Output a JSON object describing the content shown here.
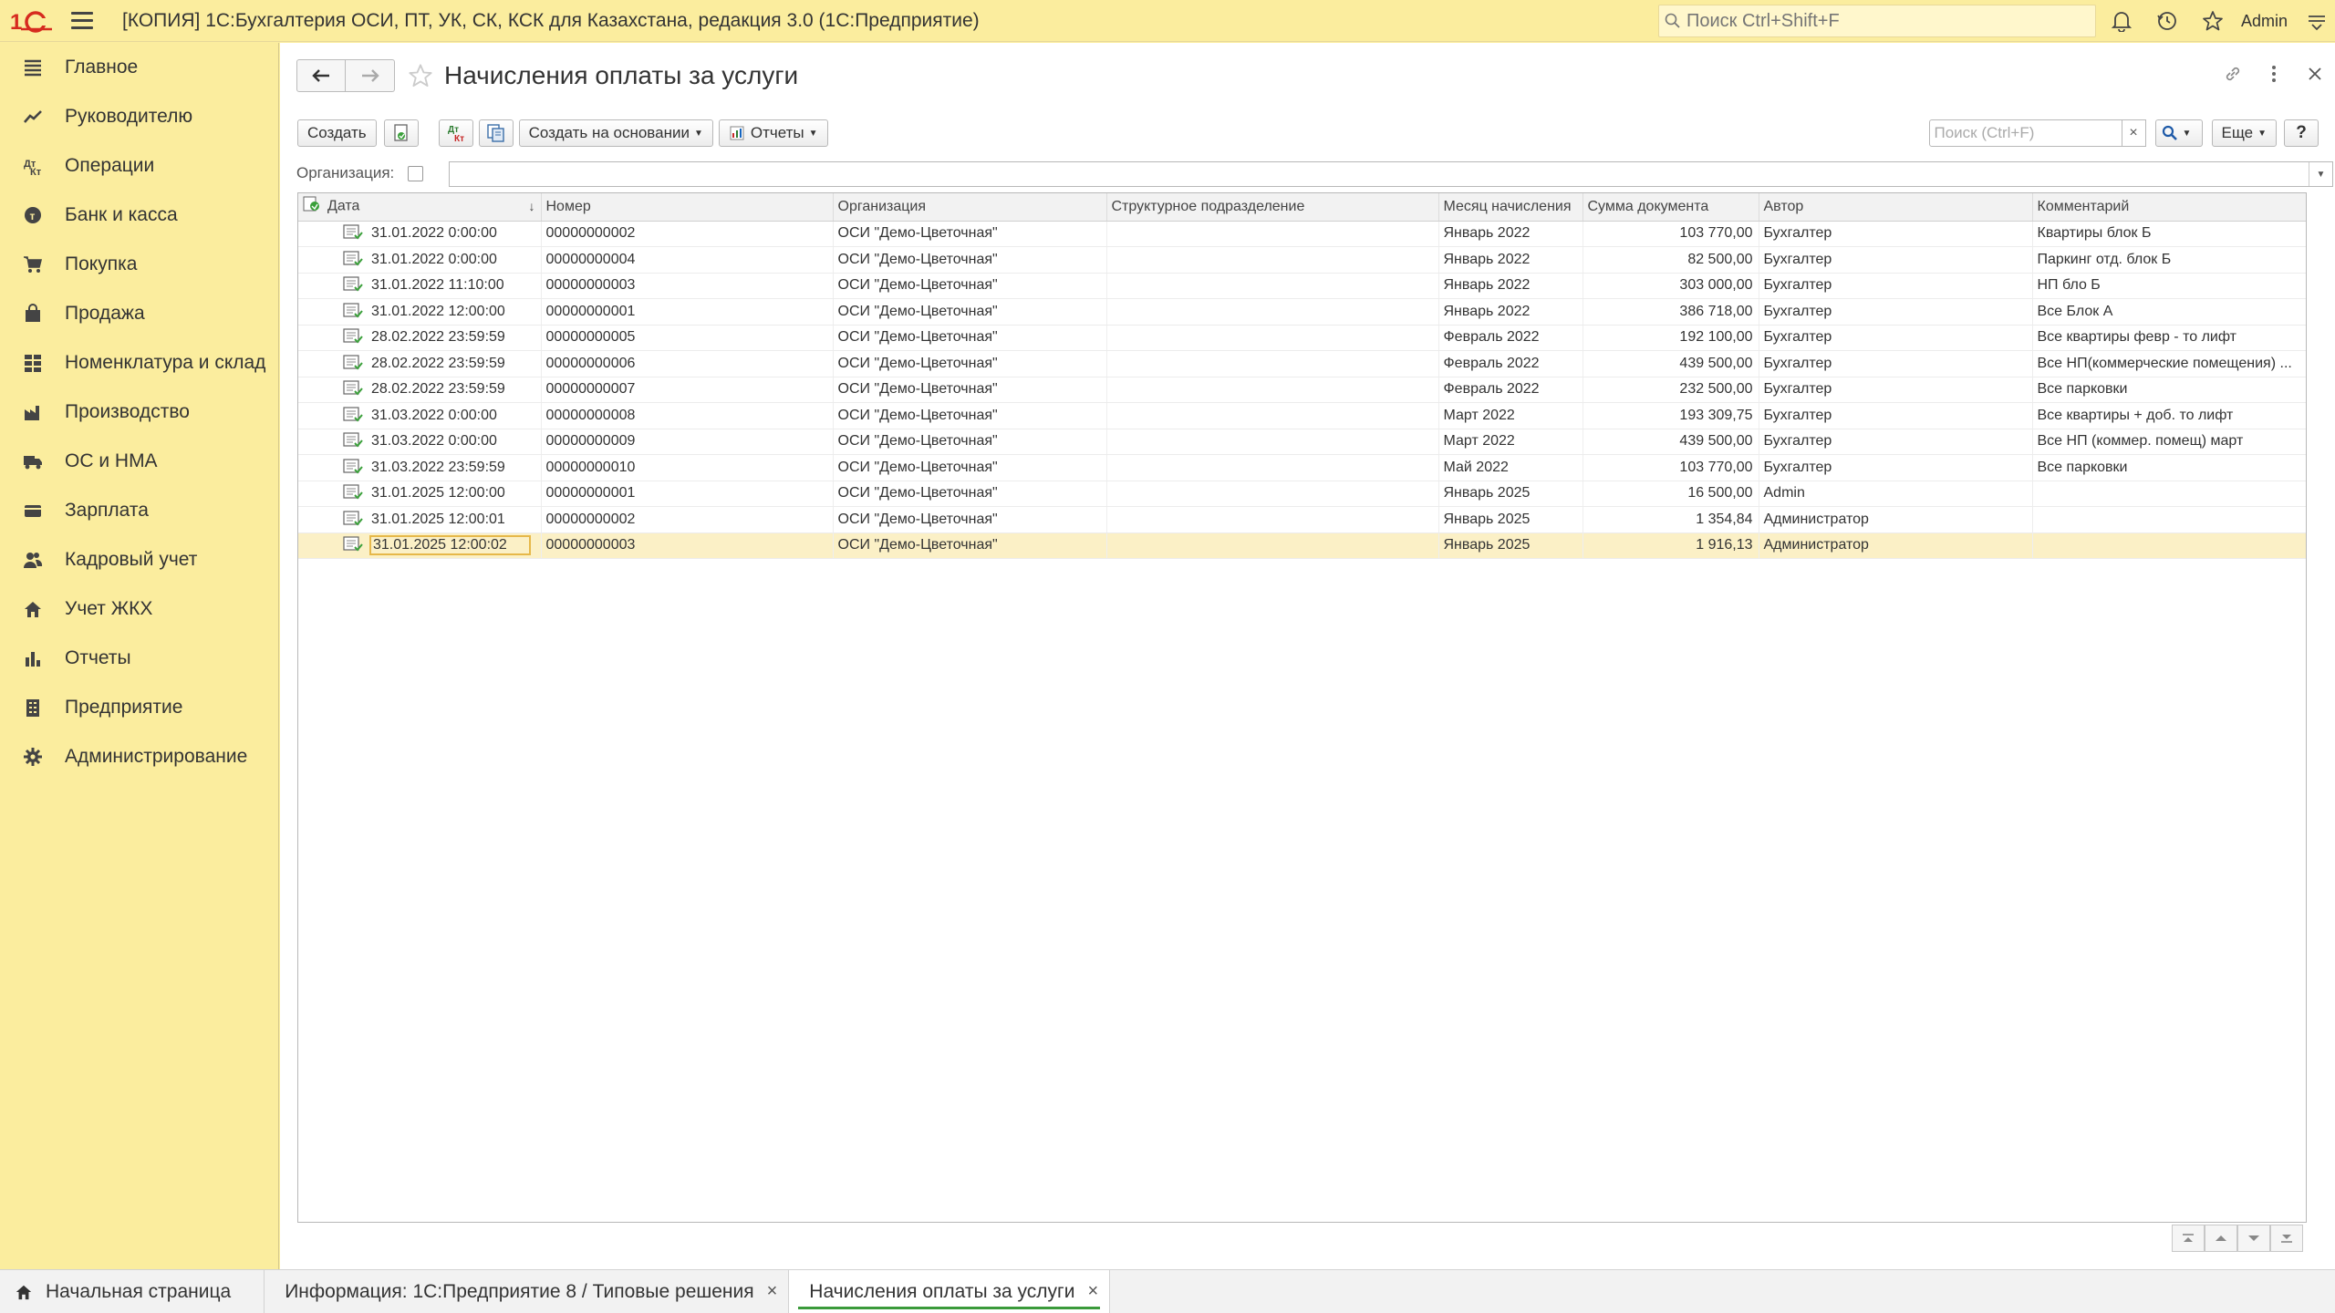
{
  "app": {
    "title": "[КОПИЯ] 1С:Бухгалтерия ОСИ, ПТ, УК, СК, КСК для Казахстана, редакция 3.0  (1С:Предприятие)",
    "search_placeholder": "Поиск Ctrl+Shift+F",
    "user": "Admin"
  },
  "sidebar": {
    "items": [
      {
        "label": "Главное",
        "icon": "menu-lines-icon"
      },
      {
        "label": "Руководителю",
        "icon": "trend-icon"
      },
      {
        "label": "Операции",
        "icon": "operations-icon"
      },
      {
        "label": "Банк и касса",
        "icon": "coins-icon"
      },
      {
        "label": "Покупка",
        "icon": "cart-icon"
      },
      {
        "label": "Продажа",
        "icon": "bag-icon"
      },
      {
        "label": "Номенклатура и склад",
        "icon": "grid-icon"
      },
      {
        "label": "Производство",
        "icon": "factory-icon"
      },
      {
        "label": "ОС и НМА",
        "icon": "truck-icon"
      },
      {
        "label": "Зарплата",
        "icon": "wallet-icon"
      },
      {
        "label": "Кадровый учет",
        "icon": "people-icon"
      },
      {
        "label": "Учет ЖКХ",
        "icon": "house-icon"
      },
      {
        "label": "Отчеты",
        "icon": "bar-chart-icon"
      },
      {
        "label": "Предприятие",
        "icon": "building-icon"
      },
      {
        "label": "Администрирование",
        "icon": "gear-icon"
      }
    ]
  },
  "form": {
    "title": "Начисления оплаты за услуги"
  },
  "toolbar": {
    "create_label": "Создать",
    "create_based_label": "Создать на основании",
    "reports_label": "Отчеты",
    "search_placeholder": "Поиск (Ctrl+F)",
    "more_label": "Еще",
    "help_label": "?"
  },
  "filter": {
    "org_label": "Организация:"
  },
  "table": {
    "columns": [
      "Дата",
      "Номер",
      "Организация",
      "Структурное подразделение",
      "Месяц начисления",
      "Сумма документа",
      "Автор",
      "Комментарий"
    ],
    "rows": [
      {
        "date": "31.01.2022 0:00:00",
        "number": "00000000002",
        "org": "ОСИ \"Демо-Цветочная\"",
        "dept": "",
        "month": "Январь 2022",
        "sum": "103 770,00",
        "author": "Бухгалтер",
        "comment": "Квартиры блок Б"
      },
      {
        "date": "31.01.2022 0:00:00",
        "number": "00000000004",
        "org": "ОСИ \"Демо-Цветочная\"",
        "dept": "",
        "month": "Январь 2022",
        "sum": "82 500,00",
        "author": "Бухгалтер",
        "comment": "Паркинг отд. блок Б"
      },
      {
        "date": "31.01.2022 11:10:00",
        "number": "00000000003",
        "org": "ОСИ \"Демо-Цветочная\"",
        "dept": "",
        "month": "Январь 2022",
        "sum": "303 000,00",
        "author": "Бухгалтер",
        "comment": "НП бло Б"
      },
      {
        "date": "31.01.2022 12:00:00",
        "number": "00000000001",
        "org": "ОСИ \"Демо-Цветочная\"",
        "dept": "",
        "month": "Январь 2022",
        "sum": "386 718,00",
        "author": "Бухгалтер",
        "comment": "Все Блок А"
      },
      {
        "date": "28.02.2022 23:59:59",
        "number": "00000000005",
        "org": "ОСИ \"Демо-Цветочная\"",
        "dept": "",
        "month": "Февраль 2022",
        "sum": "192 100,00",
        "author": "Бухгалтер",
        "comment": "Все квартиры февр - то лифт"
      },
      {
        "date": "28.02.2022 23:59:59",
        "number": "00000000006",
        "org": "ОСИ \"Демо-Цветочная\"",
        "dept": "",
        "month": "Февраль 2022",
        "sum": "439 500,00",
        "author": "Бухгалтер",
        "comment": "Все НП(коммерческие помещения) ..."
      },
      {
        "date": "28.02.2022 23:59:59",
        "number": "00000000007",
        "org": "ОСИ \"Демо-Цветочная\"",
        "dept": "",
        "month": "Февраль 2022",
        "sum": "232 500,00",
        "author": "Бухгалтер",
        "comment": "Все парковки"
      },
      {
        "date": "31.03.2022 0:00:00",
        "number": "00000000008",
        "org": "ОСИ \"Демо-Цветочная\"",
        "dept": "",
        "month": "Март 2022",
        "sum": "193 309,75",
        "author": "Бухгалтер",
        "comment": "Все квартиры + доб. то лифт"
      },
      {
        "date": "31.03.2022 0:00:00",
        "number": "00000000009",
        "org": "ОСИ \"Демо-Цветочная\"",
        "dept": "",
        "month": "Март 2022",
        "sum": "439 500,00",
        "author": "Бухгалтер",
        "comment": "Все НП (коммер. помещ) март"
      },
      {
        "date": "31.03.2022 23:59:59",
        "number": "00000000010",
        "org": "ОСИ \"Демо-Цветочная\"",
        "dept": "",
        "month": "Май 2022",
        "sum": "103 770,00",
        "author": "Бухгалтер",
        "comment": "Все парковки"
      },
      {
        "date": "31.01.2025 12:00:00",
        "number": "00000000001",
        "org": "ОСИ \"Демо-Цветочная\"",
        "dept": "",
        "month": "Январь 2025",
        "sum": "16 500,00",
        "author": "Admin",
        "comment": ""
      },
      {
        "date": "31.01.2025 12:00:01",
        "number": "00000000002",
        "org": "ОСИ \"Демо-Цветочная\"",
        "dept": "",
        "month": "Январь 2025",
        "sum": "1 354,84",
        "author": "Администратор",
        "comment": ""
      },
      {
        "date": "31.01.2025 12:00:02",
        "number": "00000000003",
        "org": "ОСИ \"Демо-Цветочная\"",
        "dept": "",
        "month": "Январь 2025",
        "sum": "1 916,13",
        "author": "Администратор",
        "comment": "",
        "selected": true
      }
    ]
  },
  "tabs": [
    {
      "label": "Начальная страница",
      "icon": "home-icon",
      "closable": false,
      "active": false
    },
    {
      "label": "Информация: 1С:Предприятие 8 / Типовые решения",
      "closable": true,
      "active": false
    },
    {
      "label": "Начисления оплаты за услуги",
      "closable": true,
      "active": true
    }
  ],
  "colors": {
    "accent_yellow": "#fbed9e",
    "selected_row": "#fbf0c6",
    "active_tab_underline": "#3a9a3a"
  }
}
